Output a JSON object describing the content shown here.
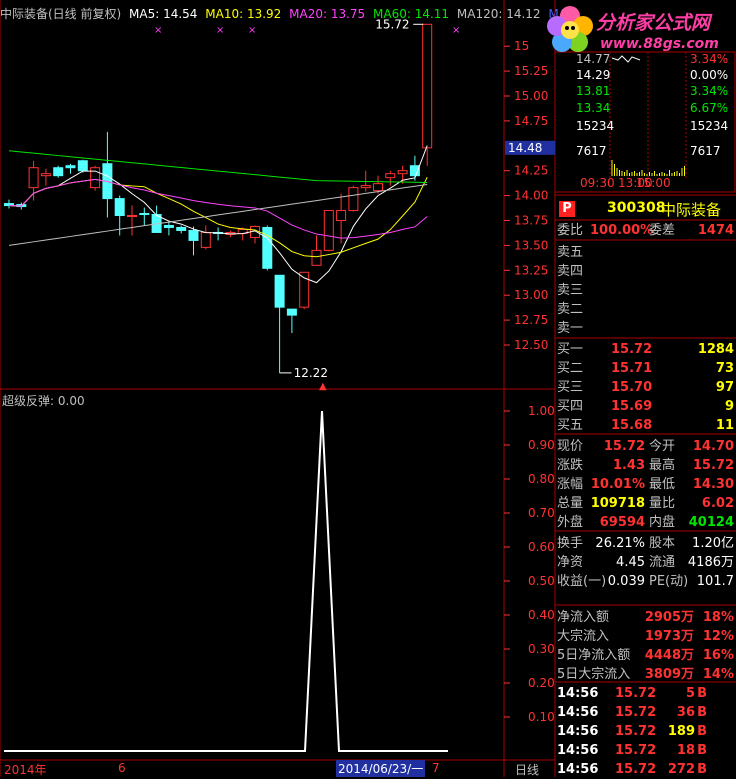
{
  "title": {
    "stock": "中际装备(日线 前复权)",
    "ma": [
      {
        "label": "MA5: 14.54",
        "color": "#ffffff"
      },
      {
        "label": "MA10: 13.92",
        "color": "#ffff00"
      },
      {
        "label": "MA20: 13.75",
        "color": "#ff44ff"
      },
      {
        "label": "MA60: 14.11",
        "color": "#00e600"
      },
      {
        "label": "MA120: 14.12",
        "color": "#c0c0c0"
      },
      {
        "label": "MA",
        "color": "#4060ff"
      }
    ]
  },
  "watermark": {
    "name": "分析家公式网",
    "url": "www.88gs.com"
  },
  "price_axis": {
    "ticks": [
      "15",
      "15.25",
      "15.00",
      "14.75",
      "14.48",
      "14.25",
      "14.00",
      "13.75",
      "13.50",
      "13.25",
      "13.00",
      "12.75",
      "12.50"
    ],
    "current": "14.48"
  },
  "annotations": {
    "high": "15.72",
    "low": "12.22"
  },
  "chart_data": {
    "type": "candlestick",
    "ohlc": [
      {
        "o": 13.92,
        "h": 13.96,
        "l": 13.87,
        "c": 13.9
      },
      {
        "o": 13.91,
        "h": 13.93,
        "l": 13.86,
        "c": 13.89
      },
      {
        "o": 14.08,
        "h": 14.35,
        "l": 13.95,
        "c": 14.28
      },
      {
        "o": 14.2,
        "h": 14.27,
        "l": 14.1,
        "c": 14.22
      },
      {
        "o": 14.28,
        "h": 14.3,
        "l": 14.18,
        "c": 14.2
      },
      {
        "o": 14.3,
        "h": 14.32,
        "l": 14.22,
        "c": 14.28
      },
      {
        "o": 14.35,
        "h": 14.36,
        "l": 14.23,
        "c": 14.25
      },
      {
        "o": 14.08,
        "h": 14.3,
        "l": 14.05,
        "c": 14.28
      },
      {
        "o": 14.32,
        "h": 14.64,
        "l": 13.78,
        "c": 13.97
      },
      {
        "o": 13.97,
        "h": 14.0,
        "l": 13.6,
        "c": 13.8
      },
      {
        "o": 13.79,
        "h": 13.9,
        "l": 13.6,
        "c": 13.8
      },
      {
        "o": 13.82,
        "h": 13.88,
        "l": 13.7,
        "c": 13.81
      },
      {
        "o": 13.81,
        "h": 13.9,
        "l": 13.65,
        "c": 13.63
      },
      {
        "o": 13.7,
        "h": 13.73,
        "l": 13.6,
        "c": 13.68
      },
      {
        "o": 13.68,
        "h": 13.7,
        "l": 13.62,
        "c": 13.65
      },
      {
        "o": 13.65,
        "h": 13.69,
        "l": 13.4,
        "c": 13.55
      },
      {
        "o": 13.48,
        "h": 13.7,
        "l": 13.46,
        "c": 13.63
      },
      {
        "o": 13.63,
        "h": 13.68,
        "l": 13.55,
        "c": 13.62
      },
      {
        "o": 13.61,
        "h": 13.65,
        "l": 13.58,
        "c": 13.63
      },
      {
        "o": 13.62,
        "h": 13.68,
        "l": 13.55,
        "c": 13.66
      },
      {
        "o": 13.58,
        "h": 13.7,
        "l": 13.52,
        "c": 13.69
      },
      {
        "o": 13.68,
        "h": 13.7,
        "l": 13.25,
        "c": 13.27
      },
      {
        "o": 13.2,
        "h": 13.2,
        "l": 12.22,
        "c": 12.88
      },
      {
        "o": 12.86,
        "h": 12.86,
        "l": 12.62,
        "c": 12.8
      },
      {
        "o": 12.88,
        "h": 13.23,
        "l": 12.86,
        "c": 13.23
      },
      {
        "o": 13.3,
        "h": 13.6,
        "l": 13.3,
        "c": 13.45
      },
      {
        "o": 13.45,
        "h": 13.85,
        "l": 13.44,
        "c": 13.85
      },
      {
        "o": 13.75,
        "h": 14.02,
        "l": 13.52,
        "c": 13.85
      },
      {
        "o": 13.85,
        "h": 14.1,
        "l": 13.84,
        "c": 14.08
      },
      {
        "o": 14.08,
        "h": 14.25,
        "l": 14.04,
        "c": 14.1
      },
      {
        "o": 14.05,
        "h": 14.2,
        "l": 14.02,
        "c": 14.12
      },
      {
        "o": 14.18,
        "h": 14.25,
        "l": 14.1,
        "c": 14.22
      },
      {
        "o": 14.22,
        "h": 14.3,
        "l": 14.12,
        "c": 14.25
      },
      {
        "o": 14.3,
        "h": 14.4,
        "l": 14.15,
        "c": 14.2
      },
      {
        "o": 14.48,
        "h": 15.72,
        "l": 14.3,
        "c": 15.72
      }
    ],
    "indicator": {
      "name": "超级反弹",
      "current": "0.00",
      "ticks": [
        "1.00",
        "0.90",
        "0.80",
        "0.70",
        "0.60",
        "0.50",
        "0.40",
        "0.30",
        "0.20",
        "0.10"
      ]
    }
  },
  "time_axis": {
    "labels": [
      "2014年",
      "6",
      "2014/06/23/一",
      "7"
    ],
    "period": "日线"
  },
  "mini_chart": {
    "left": [
      "14.77",
      "14.29",
      "13.81",
      "13.34",
      "15234",
      "7617",
      "09:30"
    ],
    "right": [
      "3.34%",
      "0.00%",
      "3.34%",
      "6.67%",
      "15234",
      "7617",
      "15:00"
    ],
    "center": "13:00"
  },
  "quote": {
    "badge": "P",
    "code": "300308",
    "name": "中际装备",
    "weibi_label": "委比",
    "weibi": "100.00%",
    "weicha_label": "委差",
    "weicha": "1474",
    "sells": [
      "卖五",
      "卖四",
      "卖三",
      "卖二",
      "卖一"
    ],
    "buys": [
      {
        "label": "买一",
        "price": "15.72",
        "vol": "1284"
      },
      {
        "label": "买二",
        "price": "15.71",
        "vol": "73"
      },
      {
        "label": "买三",
        "price": "15.70",
        "vol": "97"
      },
      {
        "label": "买四",
        "price": "15.69",
        "vol": "9"
      },
      {
        "label": "买五",
        "price": "15.68",
        "vol": "11"
      }
    ],
    "stats": [
      {
        "l1": "现价",
        "v1": "15.72",
        "l2": "今开",
        "v2": "14.70",
        "c1": "#ff3232",
        "c2": "#ff3232"
      },
      {
        "l1": "涨跌",
        "v1": "1.43",
        "l2": "最高",
        "v2": "15.72",
        "c1": "#ff3232",
        "c2": "#ff3232"
      },
      {
        "l1": "涨幅",
        "v1": "10.01%",
        "l2": "最低",
        "v2": "14.30",
        "c1": "#ff3232",
        "c2": "#ff3232"
      },
      {
        "l1": "总量",
        "v1": "109718",
        "l2": "量比",
        "v2": "6.02",
        "c1": "#ffff00",
        "c2": "#ff3232"
      },
      {
        "l1": "外盘",
        "v1": "69594",
        "l2": "内盘",
        "v2": "40124",
        "c1": "#ff3232",
        "c2": "#00e600"
      }
    ],
    "stats2": [
      {
        "l1": "换手",
        "v1": "26.21%",
        "l2": "股本",
        "v2": "1.20亿"
      },
      {
        "l1": "净资",
        "v1": "4.45",
        "l2": "流通",
        "v2": "4186万"
      },
      {
        "l1": "收益(一)",
        "v1": "0.039",
        "l2": "PE(动)",
        "v2": "101.7"
      }
    ],
    "flows": [
      {
        "label": "净流入额",
        "value": "2905万",
        "pct": "18%"
      },
      {
        "label": "大宗流入",
        "value": "1973万",
        "pct": "12%"
      },
      {
        "label": "5日净流入额",
        "value": "4448万",
        "pct": "16%"
      },
      {
        "label": "5日大宗流入",
        "value": "3809万",
        "pct": "14%"
      }
    ],
    "ticks": [
      {
        "time": "14:56",
        "price": "15.72",
        "vol": "5",
        "side": "B",
        "vcolor": "#ff3232"
      },
      {
        "time": "14:56",
        "price": "15.72",
        "vol": "36",
        "side": "B",
        "vcolor": "#ff3232"
      },
      {
        "time": "14:56",
        "price": "15.72",
        "vol": "189",
        "side": "B",
        "vcolor": "#ffff00"
      },
      {
        "time": "14:56",
        "price": "15.72",
        "vol": "18",
        "side": "B",
        "vcolor": "#ff3232"
      },
      {
        "time": "14:56",
        "price": "15.72",
        "vol": "272",
        "side": "B",
        "vcolor": "#ff3232"
      }
    ]
  }
}
